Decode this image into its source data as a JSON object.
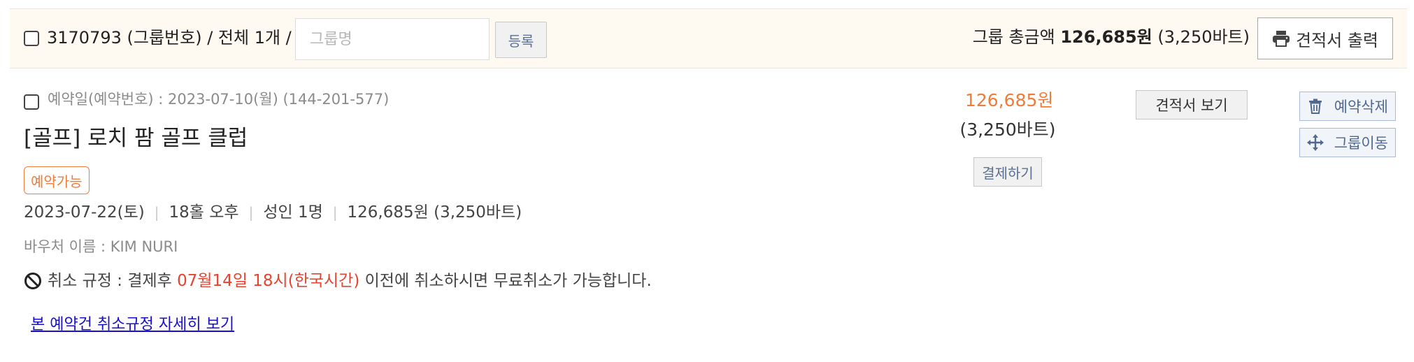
{
  "group": {
    "label": "3170793 (그룹번호) / 전체 1개 /",
    "name_placeholder": "그룹명",
    "register_label": "등록",
    "total_prefix": "그룹 총금액",
    "total_amount": "126,685원",
    "total_thb": "(3,250바트)",
    "print_label": "견적서 출력",
    "print_icon": "printer-icon"
  },
  "reservation": {
    "meta": "예약일(예약번호) : 2023-07-10(월) (144-201-577)",
    "title": "[골프] 로치 팜 골프 클럽",
    "status": "예약가능",
    "details": [
      "2023-07-22(토)",
      "18홀 오후",
      "성인 1명",
      "126,685원 (3,250바트)"
    ],
    "voucher": "바우처 이름 : KIM NURI",
    "cancel_prefix": "취소 규정 : 결제후",
    "cancel_deadline": "07월14일 18시(한국시간)",
    "cancel_suffix": "이전에 취소하시면 무료취소가 가능합니다.",
    "cancel_icon": "ban-icon",
    "detail_link": "본 예약건 취소규정 자세히 보기",
    "price": "126,685원",
    "price_thb": "(3,250바트)",
    "pay_label": "결제하기",
    "quote_view_label": "견적서 보기",
    "delete_label": "예약삭제",
    "delete_icon": "trash-icon",
    "move_label": "그룹이동",
    "move_icon": "move-arrows-icon"
  },
  "colors": {
    "accent_orange": "#f07c3a",
    "deadline_red": "#e8432f",
    "link_blue": "#1a10c9",
    "header_bg": "#fefaf1"
  }
}
